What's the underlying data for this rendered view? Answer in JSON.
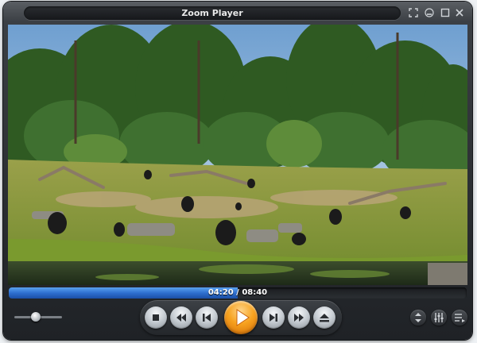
{
  "window": {
    "title": "Zoom Player"
  },
  "playback": {
    "current_time": "04:20",
    "separator": " / ",
    "total_time": "08:40",
    "progress": 0.5,
    "volume": 0.45
  },
  "icons": {
    "fullscreen": "fullscreen-icon",
    "minimize": "minimize-icon",
    "maximize": "maximize-icon",
    "close": "close-icon",
    "stop": "stop-icon",
    "rewind": "rewind-icon",
    "previous": "skip-previous-icon",
    "play": "play-icon",
    "next": "skip-next-icon",
    "fast_forward": "fast-forward-icon",
    "open": "eject-icon",
    "navigator": "up-down-arrows-icon",
    "equalizer": "equalizer-icon",
    "playlist": "playlist-icon"
  },
  "colors": {
    "accent": "#f7a21f",
    "seek_fill": "#2e6fcf"
  }
}
